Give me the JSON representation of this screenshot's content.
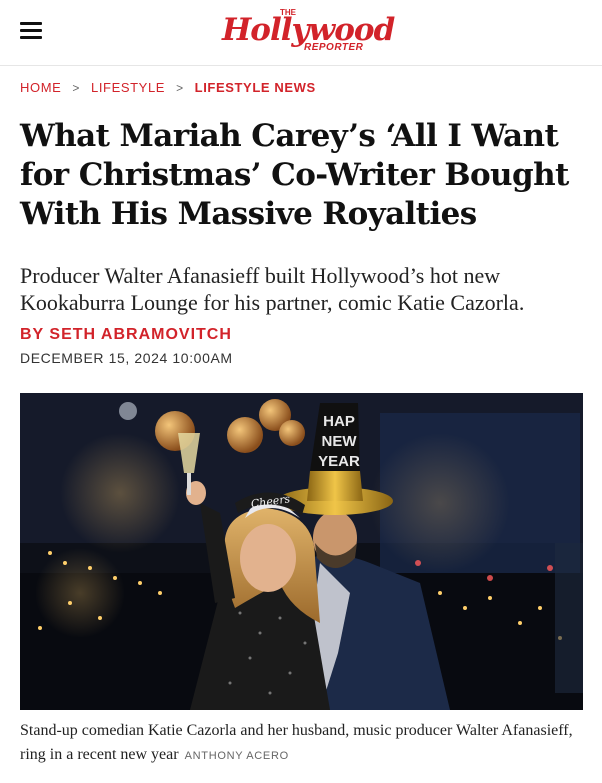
{
  "header": {
    "logo": {
      "the": "THE",
      "word": "Hollywood",
      "reporter": "REPORTER"
    }
  },
  "breadcrumb": {
    "home": "HOME",
    "section": "LIFESTYLE",
    "current": "LIFESTYLE NEWS",
    "separator": ">"
  },
  "article": {
    "headline": "What Mariah Carey’s ‘All I Want for Christmas’ Co-Writer Bought With His Massive Royalties",
    "dek": "Producer Walter Afanasieff built Hollywood’s hot new Kookaburra Lounge for his partner, comic Katie Cazorla.",
    "byline_prefix": "BY",
    "author": "SETH ABRAMOVITCH",
    "date": "DECEMBER 15, 2024 10:00AM"
  },
  "photo": {
    "hat_text": [
      "HAP",
      "NEW",
      "YEAR"
    ],
    "tiara_text": "Cheers"
  },
  "caption": {
    "text": "Stand-up comedian Katie Cazorla and her husband, music producer Walter Afanasieff, ring in a recent new year",
    "credit": "ANTHONY ACERO"
  },
  "colors": {
    "brand_red": "#d2232a",
    "text": "#111111"
  },
  "icons": {
    "menu": "hamburger-menu-icon"
  }
}
